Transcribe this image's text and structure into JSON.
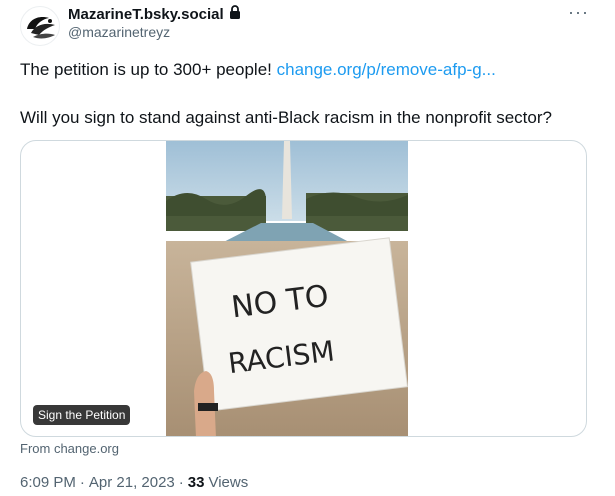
{
  "author": {
    "display_name": "MazarineT.bsky.social",
    "handle": "@mazarinetreyz",
    "lock_icon": "lock-icon",
    "avatar_icon": "avatar-logo"
  },
  "menu": {
    "more_icon": "more-horizontal-icon",
    "more_glyph": "···"
  },
  "tweet": {
    "text_line1": "The petition is up to 300+ people! ",
    "link_text": "change.org/p/remove-afp-g...",
    "text_line2": "Will you sign to stand against anti-Black racism in the nonprofit sector?"
  },
  "card": {
    "badge": "Sign the Petition",
    "source": "From change.org",
    "image_sign_text_line1": "NO TO",
    "image_sign_text_line2": "RACISM"
  },
  "meta": {
    "time": "6:09 PM",
    "separator": "·",
    "date": "Apr 21, 2023",
    "views_count": "33",
    "views_label": "Views"
  },
  "colors": {
    "link": "#1d9bf0",
    "secondary_text": "#536471",
    "primary_text": "#0f1419",
    "border": "#cfd9de"
  }
}
